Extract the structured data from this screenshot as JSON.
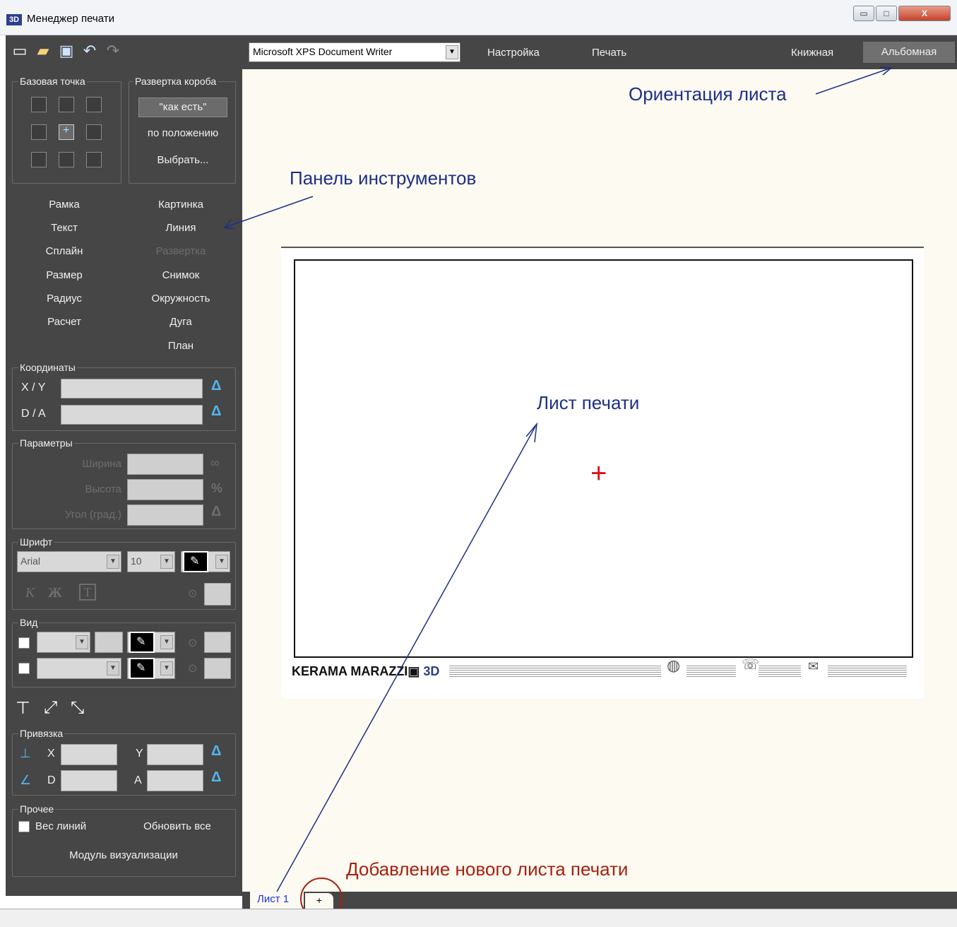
{
  "window": {
    "icon_label": "3D",
    "title": "Менеджер печати",
    "minimize": "▭",
    "maximize": "□",
    "close": "X"
  },
  "sidebar": {
    "base_point": {
      "label": "Базовая точка"
    },
    "box_unfold": {
      "label": "Развертка короба",
      "as_is": "\"как есть\"",
      "by_position": "по положению",
      "choose": "Выбрать..."
    },
    "tools": {
      "frame": "Рамка",
      "picture": "Картинка",
      "text": "Текст",
      "line": "Линия",
      "spline": "Сплайн",
      "unfold": "Развертка",
      "size": "Размер",
      "snapshot": "Снимок",
      "radius": "Радиус",
      "circle": "Окружность",
      "calc": "Расчет",
      "arc": "Дуга",
      "plan": "План"
    },
    "coords": {
      "label": "Координаты",
      "xy": "X / Y",
      "da": "D / A"
    },
    "params": {
      "label": "Параметры",
      "width": "Ширина",
      "height": "Высота",
      "angle": "Угол (град.)",
      "percent": "%"
    },
    "font": {
      "label": "Шрифт",
      "family": "Arial",
      "size": "10",
      "italic": "К",
      "bold": "Ж",
      "text_icon": "T"
    },
    "view": {
      "label": "Вид"
    },
    "snap": {
      "label": "Привязка",
      "x": "X",
      "y": "Y",
      "d": "D",
      "a": "A"
    },
    "misc": {
      "label": "Прочее",
      "line_weight": "Вес линий",
      "refresh_all": "Обновить все",
      "vis_module": "Модуль визуализации"
    }
  },
  "topbar": {
    "printer": "Microsoft XPS Document Writer",
    "setup": "Настройка",
    "print": "Печать",
    "portrait": "Книжная",
    "landscape": "Альбомная"
  },
  "annotations": {
    "orientation": "Ориентация листа",
    "toolbar_panel": "Панель инструментов",
    "print_sheet": "Лист печати",
    "add_sheet": "Добавление нового листа печати"
  },
  "sheet": {
    "brand": "KERAMA MARAZZI",
    "brand_3d": "3D"
  },
  "tabs": {
    "sheet1": "Лист 1",
    "add": "+"
  },
  "colors": {
    "panel": "#464646",
    "canvas": "#fdfaf2",
    "accent_blue": "#54b4ef",
    "annotation_blue": "#1d2f86",
    "annotation_red": "#a6210f",
    "crosshair": "#e0101a"
  }
}
